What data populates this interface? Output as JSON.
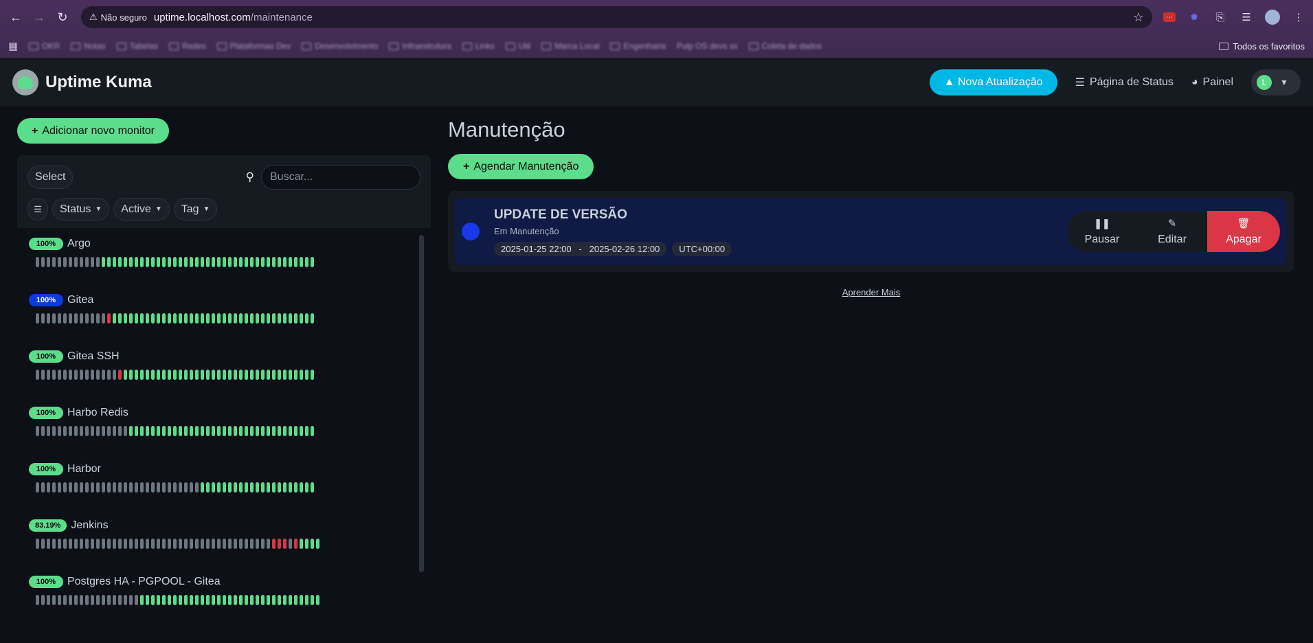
{
  "browser": {
    "security_label": "Não seguro",
    "url_host": "uptime.localhost.com",
    "url_path": "/maintenance",
    "bookmarks": [
      "OKR",
      "Notas",
      "Tabelas",
      "Redes",
      "Plataformas Dev",
      "Desenvolvimento",
      "Infraestrutura",
      "Links",
      "Util",
      "Marca Local",
      "Engenharia",
      "Pulp OS devs ss",
      "Coleta de dados"
    ],
    "all_favorites": "Todos os favoritos"
  },
  "header": {
    "brand": "Uptime Kuma",
    "update_label": "Nova Atualização",
    "status_page_label": "Página de Status",
    "dashboard_label": "Painel",
    "avatar_letter": "L"
  },
  "sidebar": {
    "add_monitor_label": "Adicionar novo monitor",
    "select_label": "Select",
    "search_placeholder": "Buscar...",
    "filters": [
      "Status",
      "Active",
      "Tag"
    ],
    "monitors": [
      {
        "name": "Argo",
        "uptime": "100%",
        "badge": "green",
        "beats": "gggggggggggguuuuuuuuuuuuuuuuuuuuuuuuuuuuuuuuuuuuuuu"
      },
      {
        "name": "Gitea",
        "uptime": "100%",
        "badge": "blue",
        "beats": "gggggggggggggduuuuuuuuuuuuuuuuuuuuuuuuuuuuuuuuuuuuu"
      },
      {
        "name": "Gitea SSH",
        "uptime": "100%",
        "badge": "green",
        "beats": "gggggggggggggggduuuuuuuuuuuuuuuuuuuuuuuuuuuuuuuuuuu"
      },
      {
        "name": "Harbo Redis",
        "uptime": "100%",
        "badge": "green",
        "beats": "ggggggggggggggggguuuuuuuuuuuuuuuuuuuuuuuuuuuuuuuuuu"
      },
      {
        "name": "Harbor",
        "uptime": "100%",
        "badge": "green",
        "beats": "gggggggggggggggggggggggggggggguuuuuuuuuuuuuuuuuuuuu"
      },
      {
        "name": "Jenkins",
        "uptime": "83.19%",
        "badge": "green",
        "beats": "gggggggggggggggggggggggggggggggggggggggggggdddgduuuu"
      },
      {
        "name": "Postgres HA - PGPOOL - Gitea",
        "uptime": "100%",
        "badge": "green",
        "beats": "ggggggggggggggggggguuuuuuuuuuuuuuuuuuuuuuuuuuuuuuuuu"
      }
    ]
  },
  "main": {
    "title": "Manutenção",
    "schedule_label": "Agendar Manutenção",
    "maintenance": {
      "title": "UPDATE DE VERSÃO",
      "status": "Em Manutenção",
      "range": "2025-01-25 22:00   -   2025-02-26 12:00",
      "timezone": "UTC+00:00",
      "pause_label": "Pausar",
      "edit_label": "Editar",
      "delete_label": "Apagar"
    },
    "learn_more": "Aprender Mais"
  }
}
